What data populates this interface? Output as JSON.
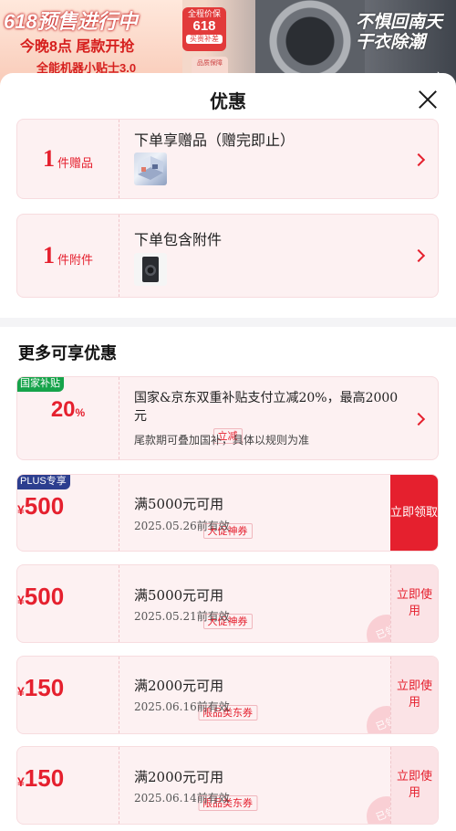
{
  "backdrop": {
    "headline": "618预售进行中",
    "subline": "今晚8点 尾款开抢",
    "third_line": "全能机器小贴士3.0",
    "badge_top": "全程价保",
    "badge_num": "618",
    "badge_bottom": "买贵补差",
    "badge2": "品质保障",
    "right_text_1": "不惧回南天",
    "right_text_2": "干衣除潮"
  },
  "sheet": {
    "title": "优惠"
  },
  "gifts": [
    {
      "count": "1",
      "unit": "件赠品",
      "title": "下单享赠品（赠完即止）",
      "thumb_icon": "room-3d-thumbnail"
    },
    {
      "count": "1",
      "unit": "件附件",
      "title": "下单包含附件",
      "thumb_icon": "washer-dryer-thumbnail"
    }
  ],
  "more_section_title": "更多可享优惠",
  "subsidy": {
    "tag": "国家补贴",
    "percent": "20",
    "percent_sign": "%",
    "sub_label": "立减",
    "text": "国家&京东双重补贴支付立减20%，最高2000元",
    "note": "尾款期可叠加国补，具体以规则为准"
  },
  "coupons": [
    {
      "tag": "PLUS专享",
      "yen": "¥",
      "amount": "500",
      "sub_label": "大促神券",
      "main": "满5000元可用",
      "date": "2025.05.26前有效",
      "action": "立即领取",
      "action_style": "red",
      "stamp": ""
    },
    {
      "tag": "",
      "yen": "¥",
      "amount": "500",
      "sub_label": "大促神券",
      "main": "满5000元可用",
      "date": "2025.05.21前有效",
      "action": "立即使用",
      "action_style": "pink",
      "stamp": "已领"
    },
    {
      "tag": "",
      "yen": "¥",
      "amount": "150",
      "sub_label": "限品类东券",
      "main": "满2000元可用",
      "date": "2025.06.16前有效",
      "action": "立即使用",
      "action_style": "pink",
      "stamp": "已领"
    },
    {
      "tag": "",
      "yen": "¥",
      "amount": "150",
      "sub_label": "限品类东券",
      "main": "满2000元可用",
      "date": "2025.06.14前有效",
      "action": "立即使用",
      "action_style": "pink",
      "stamp": "已领"
    }
  ],
  "colors": {
    "accent": "#e5202e",
    "card_bg": "#fdf1f2",
    "green_tag": "#16a34a",
    "plus_tag": "#2c3e8f"
  }
}
